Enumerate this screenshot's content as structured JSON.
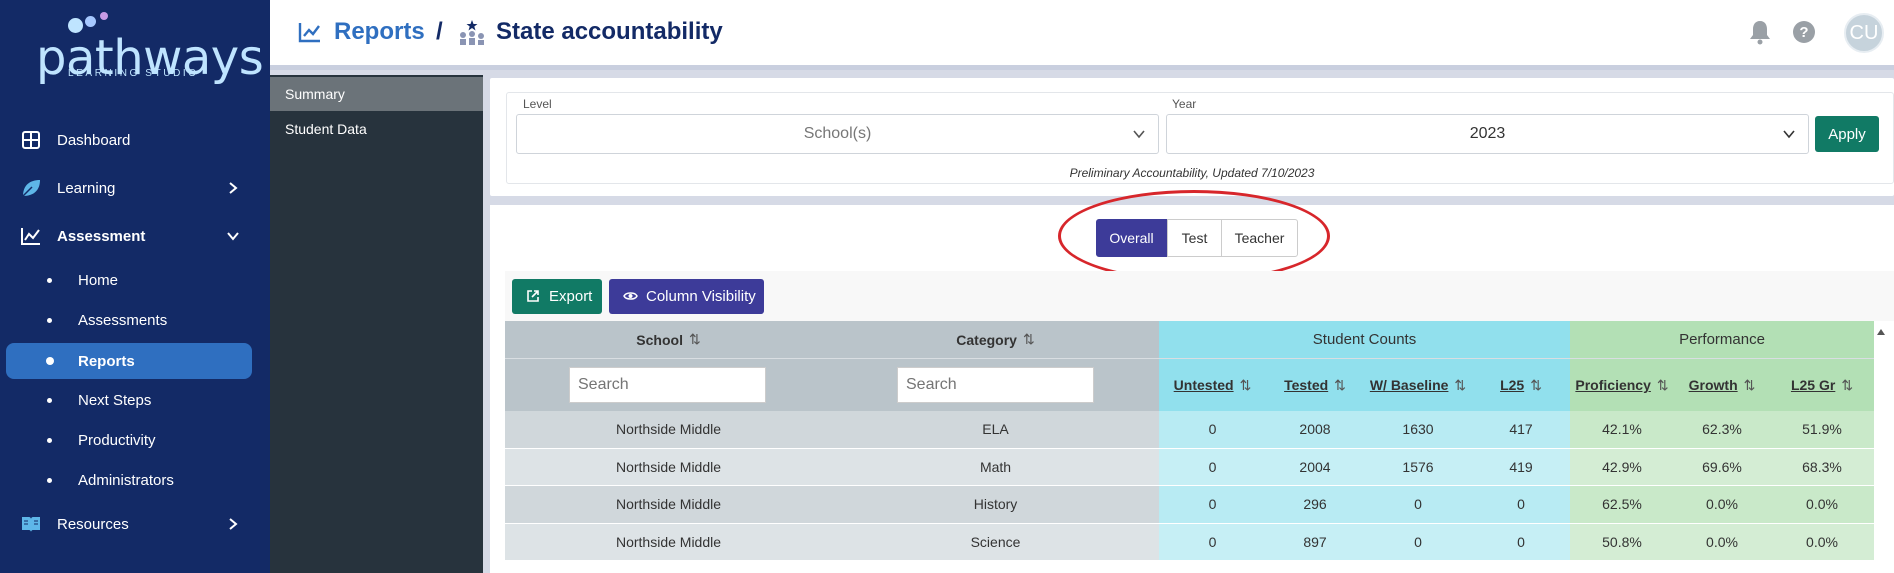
{
  "brand": {
    "logo_text": "pathways",
    "logo_sub": "LEARNING STUDIO"
  },
  "sidebar": {
    "items": [
      {
        "label": "Dashboard",
        "icon": "grid-icon"
      },
      {
        "label": "Learning",
        "icon": "leaf-icon",
        "chevron": "right"
      },
      {
        "label": "Assessment",
        "icon": "chart-icon",
        "chevron": "down"
      }
    ],
    "assessment_sub": [
      {
        "label": "Home"
      },
      {
        "label": "Assessments"
      },
      {
        "label": "Reports",
        "active": true
      },
      {
        "label": "Next Steps"
      },
      {
        "label": "Productivity"
      },
      {
        "label": "Administrators"
      }
    ],
    "resources": {
      "label": "Resources",
      "icon": "book-icon",
      "chevron": "right"
    }
  },
  "header": {
    "breadcrumb_reports": "Reports",
    "breadcrumb_sep": "/",
    "page_title": "State accountability",
    "avatar_initials": "CU"
  },
  "subnav": {
    "items": [
      {
        "label": "Summary",
        "active": true
      },
      {
        "label": "Student Data"
      }
    ]
  },
  "filters": {
    "level_label": "Level",
    "level_value": "School(s)",
    "year_label": "Year",
    "year_value": "2023",
    "apply_label": "Apply",
    "note": "Preliminary Accountability, Updated 7/10/2023"
  },
  "view_tabs": [
    {
      "label": "Overall",
      "active": true
    },
    {
      "label": "Test"
    },
    {
      "label": "Teacher"
    }
  ],
  "toolbar": {
    "export_label": "Export",
    "colvis_label": "Column Visibility"
  },
  "table": {
    "groups": {
      "student_counts": "Student Counts",
      "performance": "Performance"
    },
    "columns": {
      "school": "School",
      "category": "Category",
      "untested": "Untested",
      "tested": "Tested",
      "baseline": "W/ Baseline",
      "l25": "L25",
      "proficiency": "Proficiency",
      "growth": "Growth",
      "l25gr": "L25 Gr"
    },
    "search_placeholder": "Search",
    "rows": [
      {
        "school": "Northside Middle",
        "category": "ELA",
        "untested": "0",
        "tested": "2008",
        "baseline": "1630",
        "l25": "417",
        "proficiency": "42.1%",
        "growth": "62.3%",
        "l25gr": "51.9%"
      },
      {
        "school": "Northside Middle",
        "category": "Math",
        "untested": "0",
        "tested": "2004",
        "baseline": "1576",
        "l25": "419",
        "proficiency": "42.9%",
        "growth": "69.6%",
        "l25gr": "68.3%"
      },
      {
        "school": "Northside Middle",
        "category": "History",
        "untested": "0",
        "tested": "296",
        "baseline": "0",
        "l25": "0",
        "proficiency": "62.5%",
        "growth": "0.0%",
        "l25gr": "0.0%"
      },
      {
        "school": "Northside Middle",
        "category": "Science",
        "untested": "0",
        "tested": "897",
        "baseline": "0",
        "l25": "0",
        "proficiency": "50.8%",
        "growth": "0.0%",
        "l25gr": "0.0%"
      }
    ]
  },
  "colors": {
    "sidebar_bg": "#132a66",
    "accent_blue": "#2f6fc0",
    "teal": "#117a65",
    "indigo": "#3d3b99",
    "counts_bg": "#91e0ed",
    "perf_bg": "#b3e0b5",
    "annotation": "#d7262b"
  }
}
